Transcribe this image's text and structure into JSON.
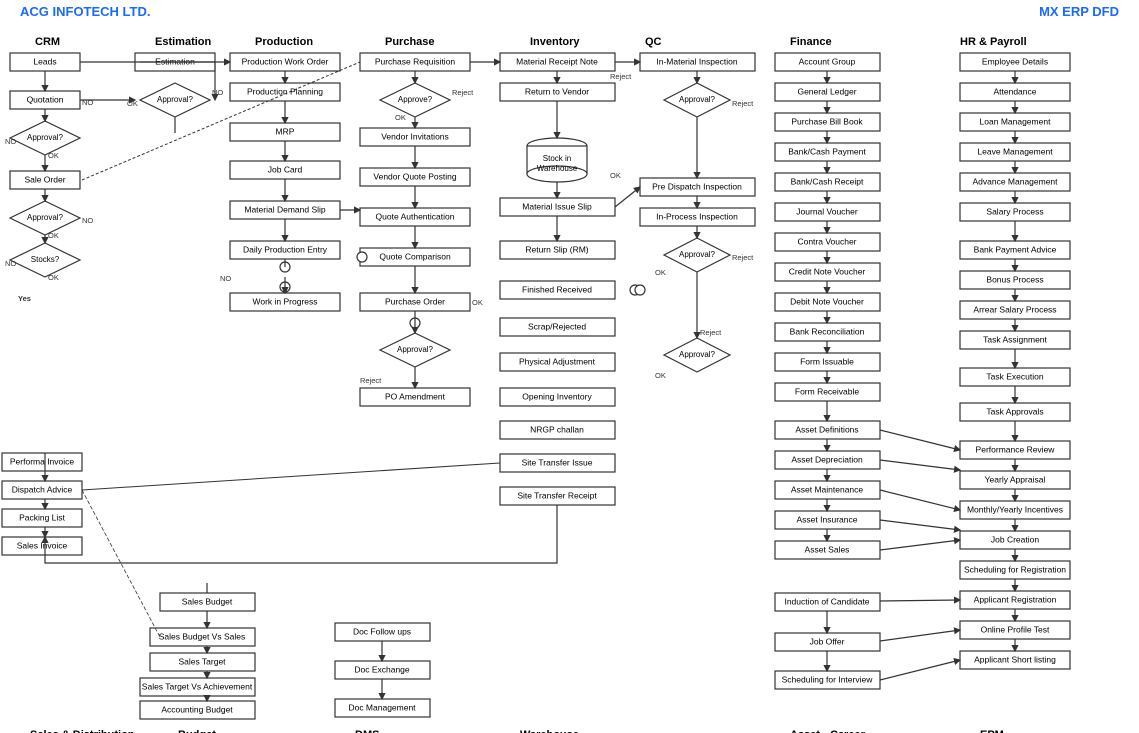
{
  "header": {
    "left": "ACG INFOTECH LTD.",
    "right": "MX ERP DFD"
  },
  "sections": {
    "crm": "CRM",
    "estimation": "Estimation",
    "production": "Production",
    "purchase": "Purchase",
    "inventory": "Inventory",
    "qc": "QC",
    "finance": "Finance",
    "hr_payroll": "HR & Payroll",
    "sales_dist": "Sales & Distribution",
    "budget": "Budget",
    "dms": "DMS",
    "warehouse": "Warehouse",
    "asset": "Asset",
    "career": "Career",
    "epm": "EPM"
  }
}
